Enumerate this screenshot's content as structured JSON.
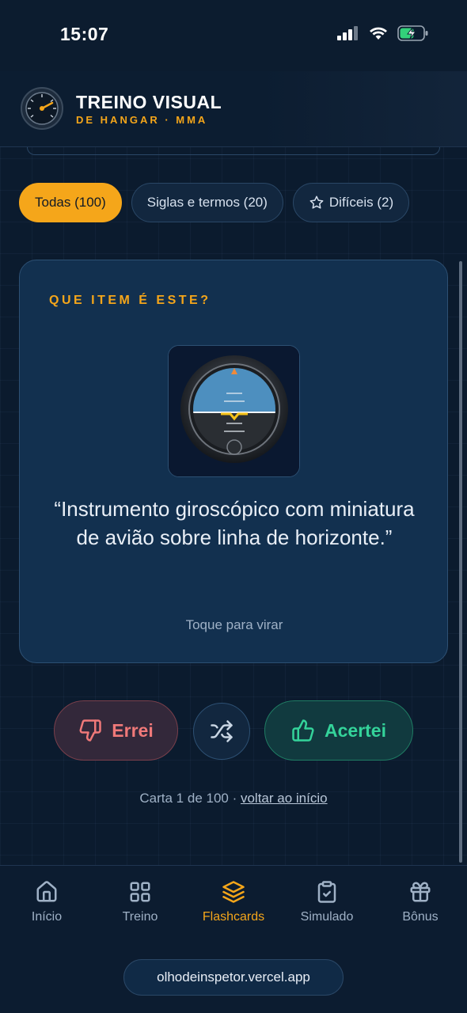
{
  "status_bar": {
    "time": "15:07"
  },
  "header": {
    "title": "TREINO VISUAL",
    "subtitle": "DE HANGAR · MMA"
  },
  "filters": [
    {
      "label": "Todas (100)",
      "active": true
    },
    {
      "label": "Siglas e termos (20)",
      "active": false
    },
    {
      "label": "Difíceis (2)",
      "active": false,
      "icon": "star-icon"
    }
  ],
  "card": {
    "eyebrow": "QUE ITEM É ESTE?",
    "image": "attitude-indicator-instrument",
    "quote": "“Instrumento giroscópico com miniatura de avião sobre linha de horizonte.”",
    "hint": "Toque para virar"
  },
  "actions": {
    "wrong_label": "Errei",
    "right_label": "Acertei",
    "shuffle_icon": "shuffle-icon"
  },
  "counter": {
    "text": "Carta 1 de 100 · ",
    "link": "voltar ao início"
  },
  "nav": [
    {
      "label": "Início",
      "icon": "home-icon",
      "active": false
    },
    {
      "label": "Treino",
      "icon": "grid-icon",
      "active": false
    },
    {
      "label": "Flashcards",
      "icon": "layers-icon",
      "active": true
    },
    {
      "label": "Simulado",
      "icon": "clipboard-check-icon",
      "active": false
    },
    {
      "label": "Bônus",
      "icon": "gift-icon",
      "active": false
    }
  ],
  "url": "olhodeinspetor.vercel.app",
  "colors": {
    "accent": "#f5a61a",
    "background": "#0b1b2e",
    "wrong": "#f07979",
    "right": "#34d39a"
  }
}
